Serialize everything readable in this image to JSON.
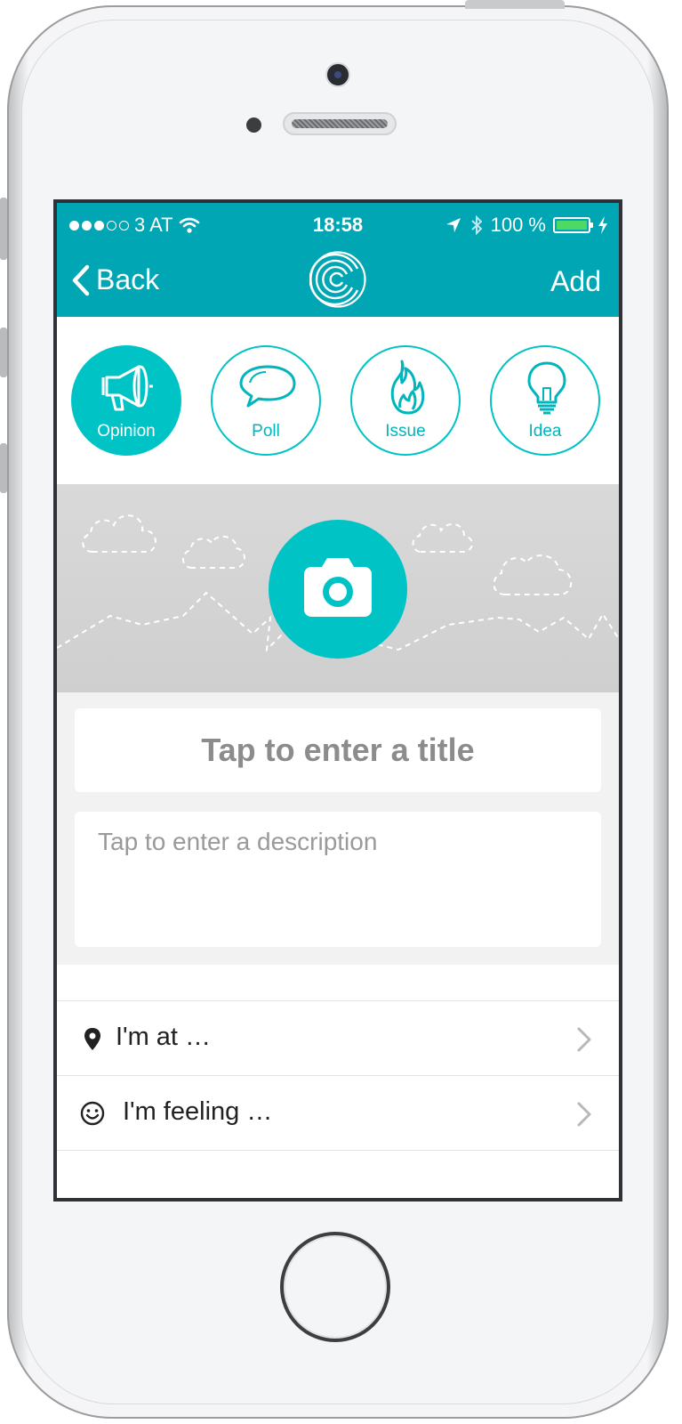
{
  "status_bar": {
    "carrier": "3 AT",
    "time": "18:58",
    "battery": "100 %",
    "signal_bars_filled": 3,
    "signal_bars_total": 5
  },
  "nav": {
    "back_label": "Back",
    "add_label": "Add",
    "logo_icon": "concentric-c-logo"
  },
  "post_types": [
    {
      "label": "Opinion",
      "icon": "megaphone-icon",
      "selected": true
    },
    {
      "label": "Poll",
      "icon": "speech-bubble-icon",
      "selected": false
    },
    {
      "label": "Issue",
      "icon": "flame-icon",
      "selected": false
    },
    {
      "label": "Idea",
      "icon": "lightbulb-icon",
      "selected": false
    }
  ],
  "cover": {
    "icon": "camera-icon"
  },
  "form": {
    "title_placeholder": "Tap to enter a title",
    "description_placeholder": "Tap to enter a description"
  },
  "options": [
    {
      "label": "I'm at …",
      "icon": "location-pin-icon"
    },
    {
      "label": "I'm feeling …",
      "icon": "smiley-icon"
    }
  ],
  "colors": {
    "accent": "#00a6b4",
    "accent_light": "#00c3c6",
    "battery_fill": "#4cd964"
  }
}
